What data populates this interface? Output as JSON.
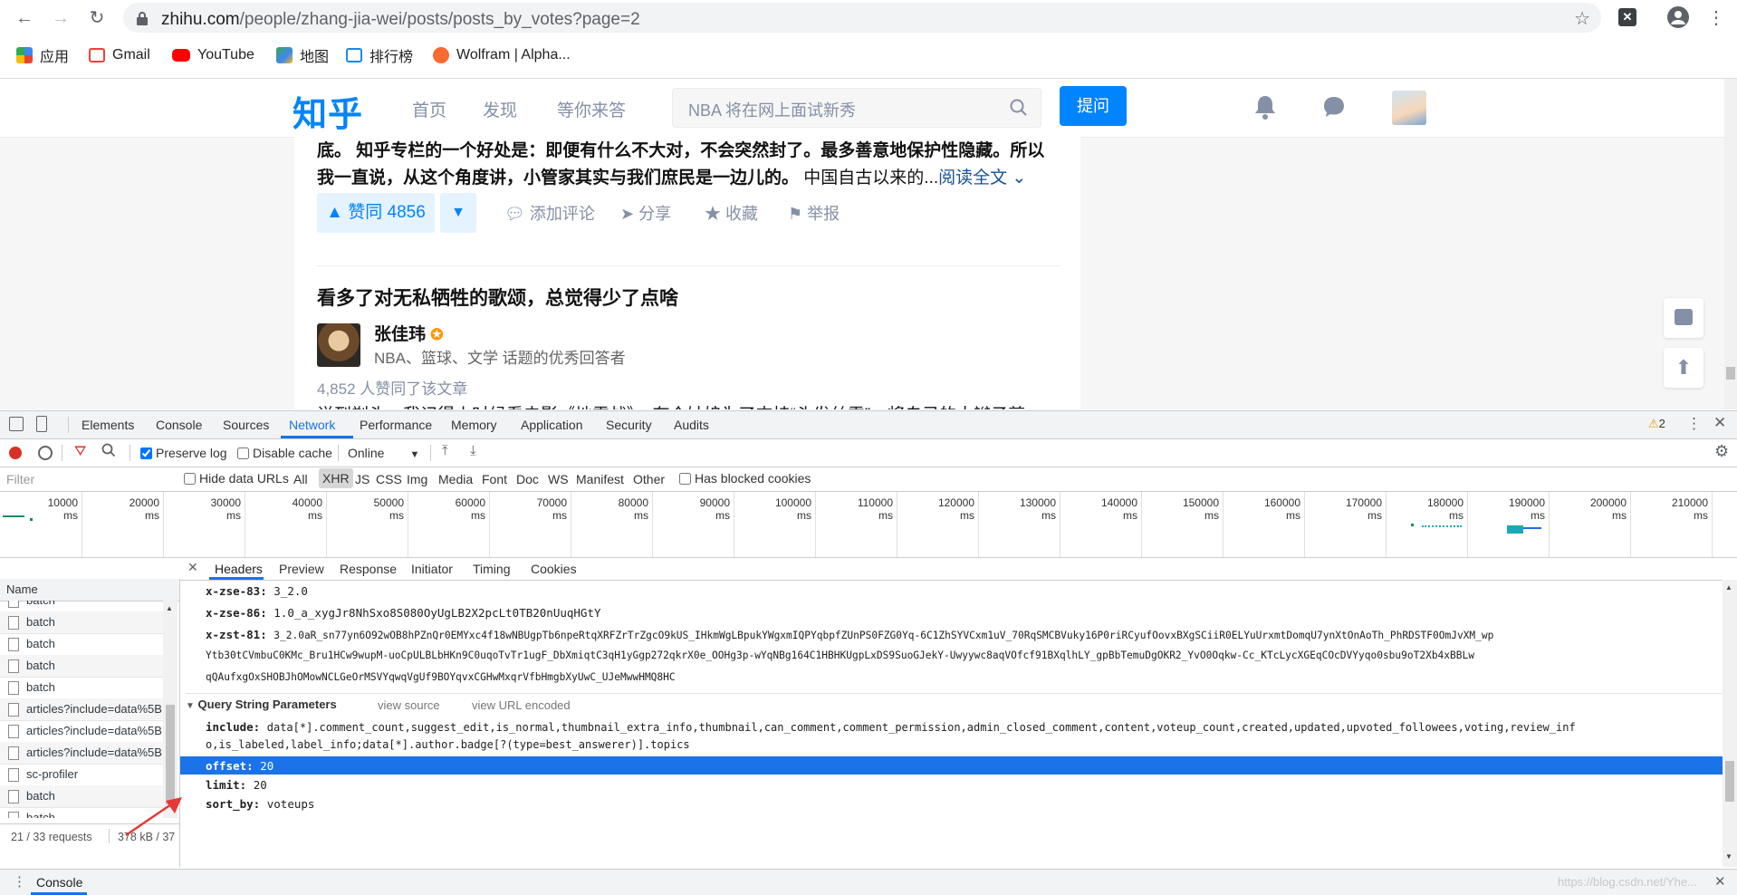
{
  "browser": {
    "url_host": "zhihu.com",
    "url_path": "/people/zhang-jia-wei/posts/posts_by_votes?page=2",
    "bookmarks": [
      {
        "label": "应用",
        "color": "#4285f4"
      },
      {
        "label": "Gmail",
        "color": "#ea4335"
      },
      {
        "label": "YouTube",
        "color": "#ff0000"
      },
      {
        "label": "地图",
        "color": "#34a853"
      },
      {
        "label": "排行榜",
        "color": "#1e88e5"
      },
      {
        "label": "Wolfram | Alpha...",
        "color": "#f96932"
      }
    ]
  },
  "zhihu": {
    "logo": "知乎",
    "nav": [
      "首页",
      "发现",
      "等你来答"
    ],
    "search_placeholder": "NBA 将在网上面试新秀",
    "ask_label": "提问",
    "excerpt_line1": "底。 知乎专栏的一个好处是：即便有什么不大对，不会突然封了。最多善意地保护性隐藏。所以",
    "excerpt_line2": "我一直说，从这个角度讲，小管家其实与我们庶民是一边儿的。",
    "excerpt_tail": " 中国自古以来的...",
    "read_more": "阅读全文",
    "vote_label": "▲ 赞同 4856",
    "actions": [
      "添加评论",
      "分享",
      "收藏",
      "举报"
    ],
    "post2_title": "看多了对无私牺牲的歌颂，总觉得少了点啥",
    "author_name": "张佳玮",
    "author_desc": "NBA、篮球、文学 话题的优秀回答者",
    "likes": "4,852 人赞同了该文章",
    "post2_excerpt": "说到剃头，我记得小时候看电影《地雷战》，有个姑娘为了支持“头发丝雷”，将自己的大辫子剪"
  },
  "devtools": {
    "tabs": [
      "Elements",
      "Console",
      "Sources",
      "Network",
      "Performance",
      "Memory",
      "Application",
      "Security",
      "Audits"
    ],
    "active_tab": "Network",
    "warning_count": "2",
    "preserve_log": "Preserve log",
    "disable_cache": "Disable cache",
    "throttle": "Online",
    "filter_placeholder": "Filter",
    "hide_data_urls": "Hide data URLs",
    "type_filters": [
      "All",
      "XHR",
      "JS",
      "CSS",
      "Img",
      "Media",
      "Font",
      "Doc",
      "WS",
      "Manifest",
      "Other"
    ],
    "active_type": "XHR",
    "has_blocked": "Has blocked cookies",
    "timeline_ticks": [
      "10000 ms",
      "20000 ms",
      "30000 ms",
      "40000 ms",
      "50000 ms",
      "60000 ms",
      "70000 ms",
      "80000 ms",
      "90000 ms",
      "100000 ms",
      "110000 ms",
      "120000 ms",
      "130000 ms",
      "140000 ms",
      "150000 ms",
      "160000 ms",
      "170000 ms",
      "180000 ms",
      "190000 ms",
      "200000 ms",
      "210000 ms"
    ],
    "name_header": "Name",
    "requests": [
      "batch",
      "batch",
      "batch",
      "batch",
      "batch",
      "articles?include=data%5B",
      "articles?include=data%5B",
      "articles?include=data%5B",
      "sc-profiler",
      "batch",
      "batch"
    ],
    "status_requests": "21 / 33 requests",
    "status_size": "378 kB / 37",
    "detail_tabs": [
      "Headers",
      "Preview",
      "Response",
      "Initiator",
      "Timing",
      "Cookies"
    ],
    "headers": [
      {
        "k": "x-zse-83:",
        "v": "3_2.0"
      },
      {
        "k": "x-zse-86:",
        "v": "1.0_a_xygJr8NhSxo8S080OyUgLB2X2pcLt0TB20nUuqHGtY"
      },
      {
        "k": "x-zst-81:",
        "v": "3_2.0aR_sn77yn6O92wOB8hPZnQr0EMYxc4f18wNBUgpTb6npeRtqXRFZrTrZgcO9kUS_IHkmWgLBpukYWgxmIQPYqbpfZUnPS0FZG0Yq-6C1ZhSYVCxm1uV_70RqSMCBVuky16P0riRCyufOovxBXgSCiiR0ELYuUrxmtDomqU7ynXtOnAoTh_PhRDSTF0OmJvXM_wp"
      },
      {
        "k": "",
        "v": "Ytb30tCVmbuC0KMc_Bru1HCw9wupM-uoCpULBLbHKn9C0uqoTvTr1ugF_DbXmiqtC3qH1yGgp272qkrX0e_OOHg3p-wYqNBg164C1HBHKUgpLxDS9SuoGJekY-Uwyywc8aqVOfcf91BXqlhLY_gpBbTemuDgOKR2_YvO0Oqkw-Cc_KTcLycXGEqCOcDVYyqo0sbu9oT2Xb4xBBLw"
      },
      {
        "k": "",
        "v": "qQAufxgOxSHOBJhOMowNCLGeOrMSVYqwqVgUf9BOYqvxCGHwMxqrVfbHmgbXyUwC_UJeMwwHMQ8HC"
      }
    ],
    "qs_title": "Query String Parameters",
    "view_source": "view source",
    "view_url_encoded": "view URL encoded",
    "qs_include_key": "include:",
    "qs_include_1": "data[*].comment_count,suggest_edit,is_normal,thumbnail_extra_info,thumbnail,can_comment,comment_permission,admin_closed_comment,content,voteup_count,created,updated,upvoted_followees,voting,review_inf",
    "qs_include_2": "o,is_labeled,label_info;data[*].author.badge[?(type=best_answerer)].topics",
    "qs_params": [
      {
        "k": "offset:",
        "v": "20"
      },
      {
        "k": "limit:",
        "v": "20"
      },
      {
        "k": "sort_by:",
        "v": "voteups"
      }
    ],
    "console_tab": "Console",
    "watermark": "https://blog.csdn.net/Yhe..."
  }
}
